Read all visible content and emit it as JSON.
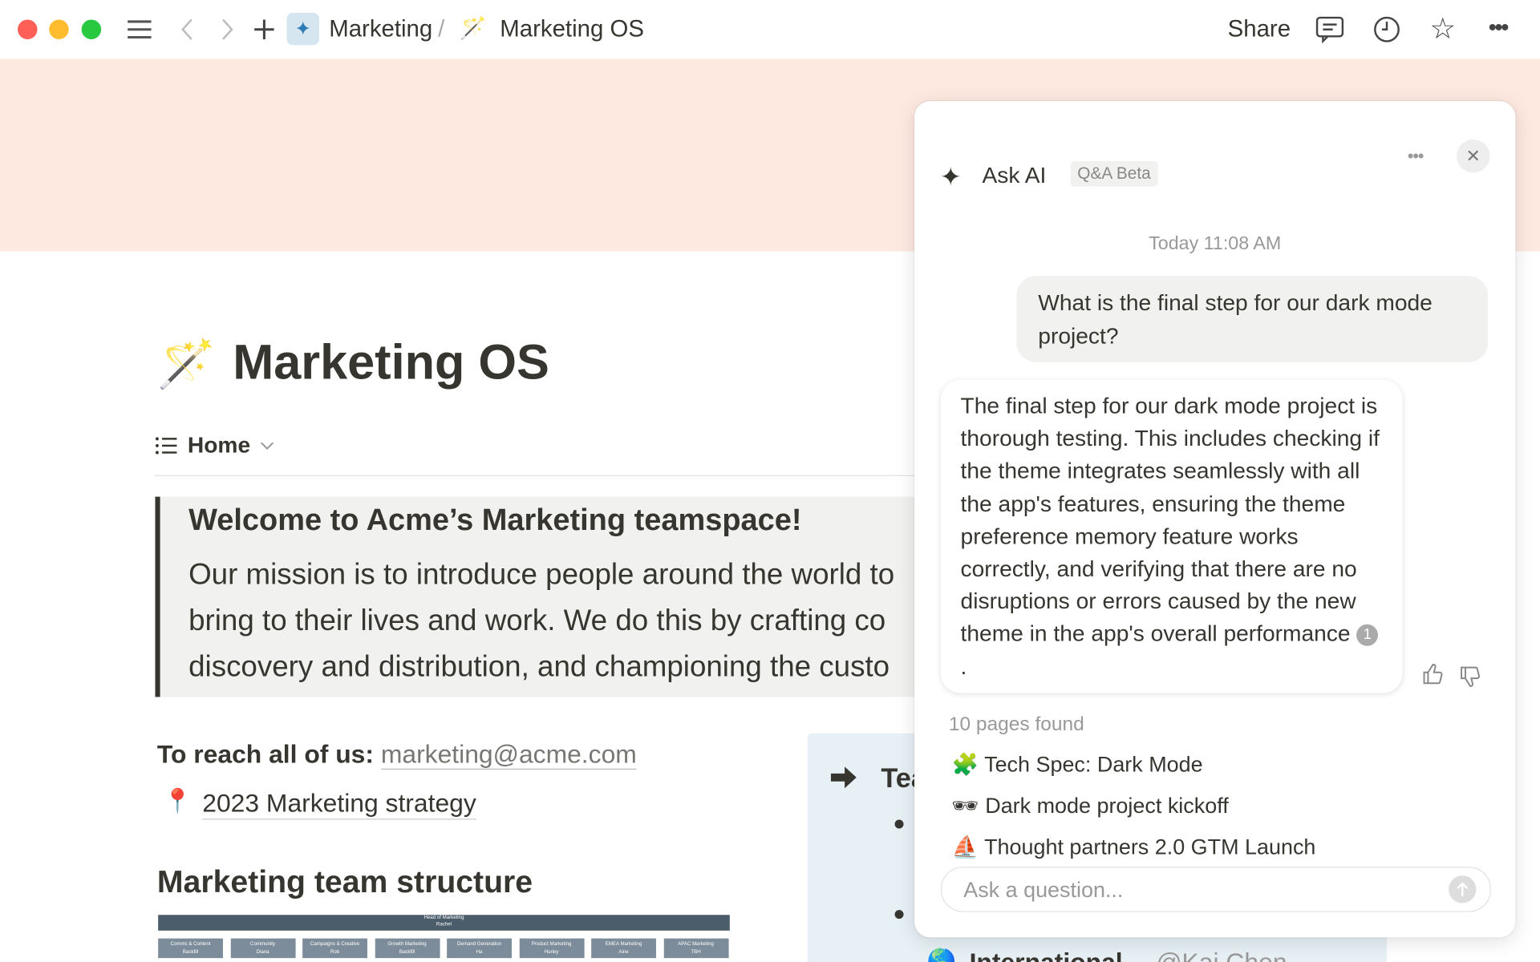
{
  "topbar": {
    "breadcrumb": [
      {
        "label": "Marketing",
        "icon": "sparkles-icon"
      },
      {
        "label": "Marketing OS",
        "icon": "magic-wand-icon"
      }
    ],
    "separator": "/",
    "share_label": "Share",
    "window_controls": {
      "close": "#ff5f57",
      "minimize": "#febc2e",
      "zoom": "#28c840"
    }
  },
  "page": {
    "cover_color": "#fde9e0",
    "icon": "🪄",
    "title": "Marketing OS",
    "view_tab": "Home",
    "callout": {
      "heading": "Welcome to Acme’s Marketing teamspace!",
      "lines": [
        "Our mission is to introduce people around the world to",
        "bring to their lives and work. We do this by crafting co",
        "discovery and distribution, and championing the custo"
      ]
    },
    "contact_label": "To reach all of us:",
    "contact_email": "marketing@acme.com",
    "strategy_icon": "📍",
    "strategy_link": "2023 Marketing strategy",
    "structure_heading": "Marketing team structure",
    "org_chart": {
      "head": {
        "role": "Head of Marketing",
        "name": "Rachel"
      },
      "teams": [
        {
          "role": "Comms & Content",
          "name": "Backfill"
        },
        {
          "role": "Community",
          "name": "Diana"
        },
        {
          "role": "Campaigns & Creative",
          "name": "Rob"
        },
        {
          "role": "Growth Marketing",
          "name": "Backfill"
        },
        {
          "role": "Demand Generation",
          "name": "Ha"
        },
        {
          "role": "Product Marketing",
          "name": "Hurley"
        },
        {
          "role": "EMEA Marketing",
          "name": "Aine"
        },
        {
          "role": "APAC Marketing",
          "name": "TBH"
        }
      ]
    },
    "teams_callout": {
      "title": "Tea",
      "item": "International",
      "mention": "@Kai Chen"
    }
  },
  "ai_panel": {
    "title": "Ask AI",
    "badge": "Q&A Beta",
    "timestamp": "Today 11:08 AM",
    "question": "What is the final step for our dark mode project?",
    "answer": "The final step for our dark mode project is thorough testing. This includes checking if the theme integrates seamlessly with all the app's features, ensuring the theme preference memory feature works correctly, and verifying that there are no disruptions or errors caused by the new theme in the app's overall performance",
    "citation": "1",
    "answer_end": ".",
    "pages_found": "10 pages found",
    "sources": [
      {
        "icon": "🧩",
        "label": "Tech Spec: Dark Mode"
      },
      {
        "icon": "🕶",
        "label": "Dark mode project kickoff"
      },
      {
        "icon": "⛵",
        "label": "Thought partners 2.0 GTM Launch"
      }
    ],
    "input_placeholder": "Ask a question..."
  }
}
